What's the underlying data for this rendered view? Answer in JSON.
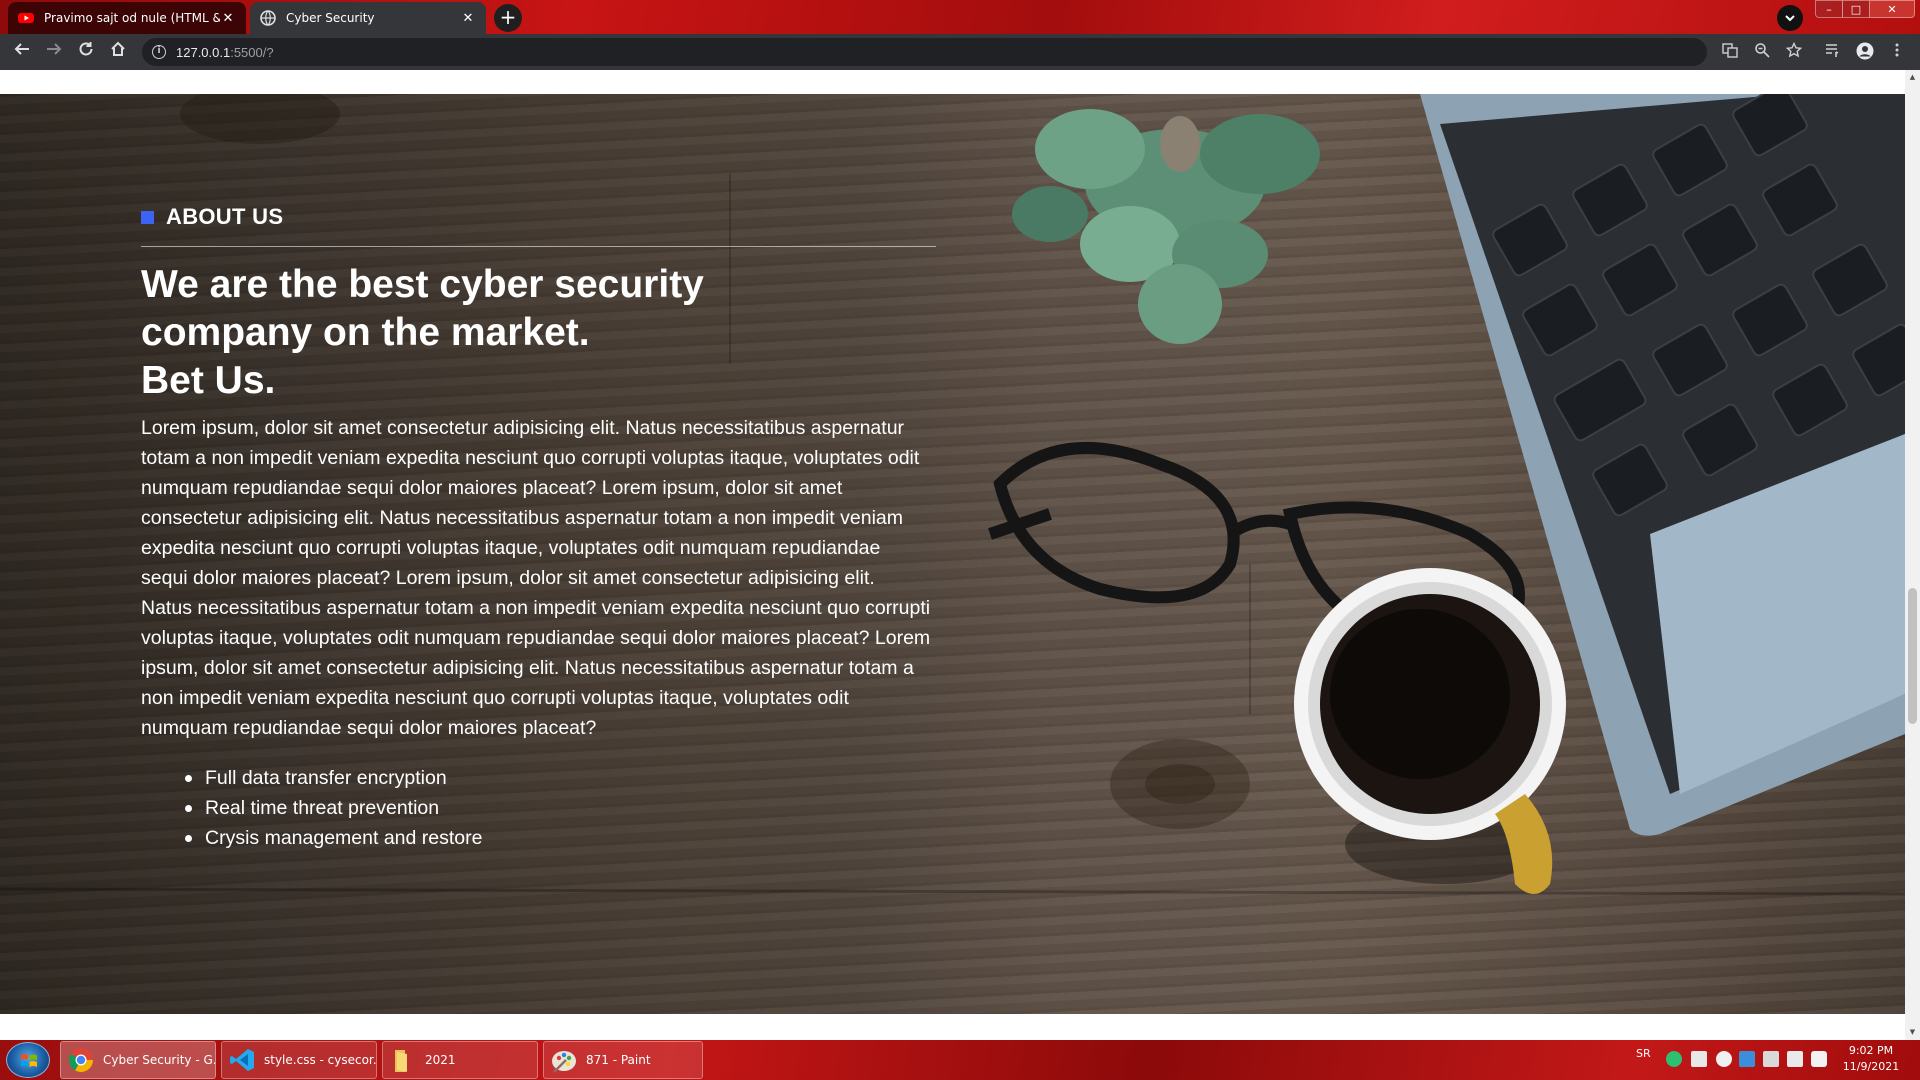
{
  "browser": {
    "tabs": [
      {
        "title": "Pravimo sajt od nule (HTML & CSS)",
        "active": false,
        "favicon": "youtube-icon",
        "close": "✕"
      },
      {
        "title": "Cyber Security",
        "active": true,
        "favicon": "globe-icon",
        "close": "✕"
      }
    ],
    "new_tab": "+",
    "url_host": "127.0.0.1",
    "url_rest": ":5500/?",
    "window_controls": {
      "minimize": "–",
      "maximize": "□",
      "close": "✕"
    }
  },
  "page": {
    "about": {
      "label": "ABOUT US",
      "headline_lines": [
        "We are the best cyber security",
        "company on the market.",
        "Bet Us."
      ],
      "body": "Lorem ipsum, dolor sit amet consectetur adipisicing elit. Natus necessitatibus aspernatur totam a non impedit veniam expedita nesciunt quo corrupti voluptas itaque, voluptates odit numquam repudiandae sequi dolor maiores placeat? Lorem ipsum, dolor sit amet consectetur adipisicing elit. Natus necessitatibus aspernatur totam a non impedit veniam expedita nesciunt quo corrupti voluptas itaque, voluptates odit numquam repudiandae sequi dolor maiores placeat? Lorem ipsum, dolor sit amet consectetur adipisicing elit. Natus necessitatibus aspernatur totam a non impedit veniam expedita nesciunt quo corrupti voluptas itaque, voluptates odit numquam repudiandae sequi dolor maiores placeat? Lorem ipsum, dolor sit amet consectetur adipisicing elit. Natus necessitatibus aspernatur totam a non impedit veniam expedita nesciunt quo corrupti voluptas itaque, voluptates odit numquam repudiandae sequi dolor maiores placeat?",
      "features": [
        "Full data transfer encryption",
        "Real time threat prevention",
        "Crysis management and restore"
      ],
      "accent_color": "#3d63f5"
    }
  },
  "taskbar": {
    "items": [
      {
        "label": "Cyber Security - G...",
        "icon": "chrome-icon",
        "active": true
      },
      {
        "label": "style.css - cysecor...",
        "icon": "vscode-icon",
        "active": false
      },
      {
        "label": "2021",
        "icon": "folder-icon",
        "active": false
      },
      {
        "label": "871 - Paint",
        "icon": "paint-icon",
        "active": false
      }
    ],
    "language": "SR",
    "time": "9:02 PM",
    "date": "11/9/2021"
  }
}
